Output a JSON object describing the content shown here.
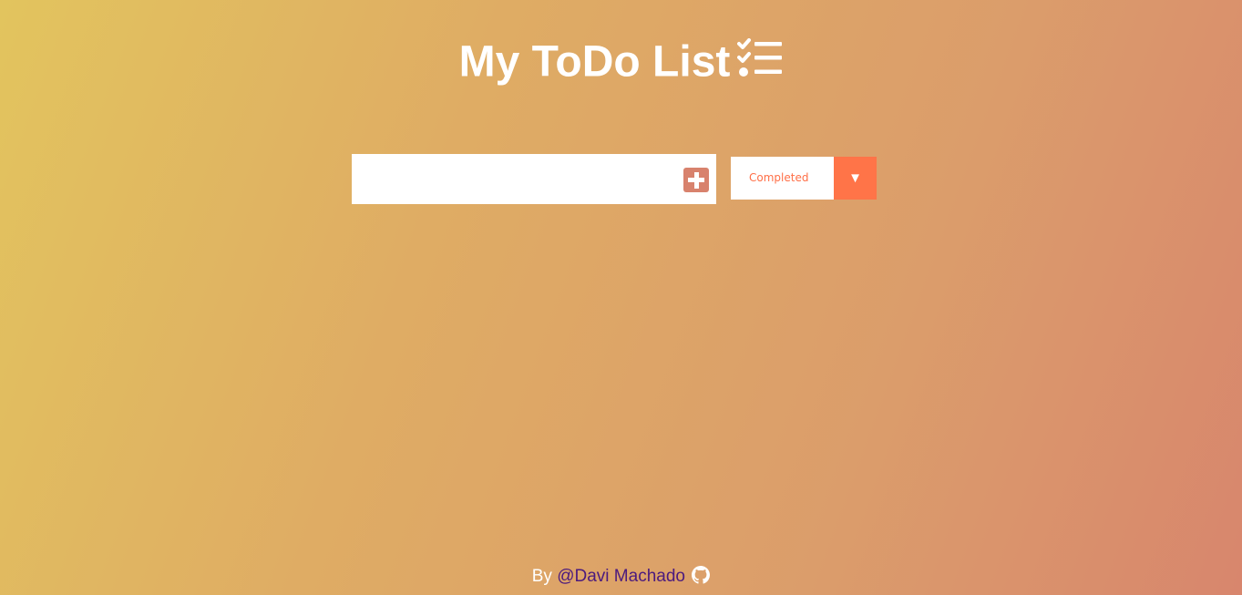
{
  "header": {
    "title": "My ToDo List",
    "icon": "tasks-checklist-icon"
  },
  "todo_form": {
    "input_value": "",
    "input_placeholder": "",
    "add_icon": "plus-square-icon"
  },
  "filter": {
    "selected": "Completed",
    "arrow_icon": "caret-down-icon",
    "arrow_glyph": "▼"
  },
  "todos": [],
  "footer": {
    "prefix": "By",
    "author_link": "@Davi Machado",
    "icon": "github-icon"
  },
  "colors": {
    "gradient_start": "#e2c45e",
    "gradient_end": "#d8866d",
    "accent": "#ff7448",
    "add_button": "#d8826d",
    "filter_text": "#ff6f47",
    "link": "#4b1a7e"
  }
}
